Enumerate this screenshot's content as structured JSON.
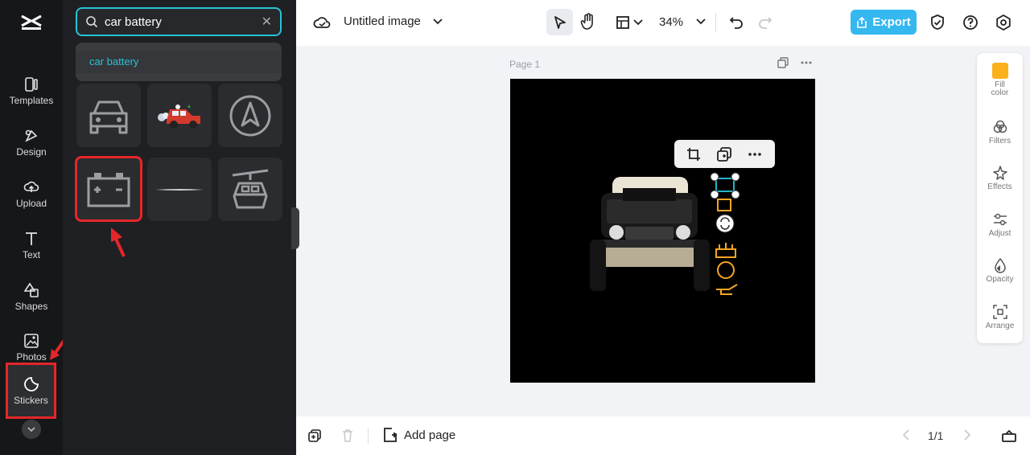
{
  "nav": {
    "items": [
      {
        "label": "Templates",
        "icon": "templates-icon"
      },
      {
        "label": "Design",
        "icon": "design-icon"
      },
      {
        "label": "Upload",
        "icon": "upload-icon"
      },
      {
        "label": "Text",
        "icon": "text-icon"
      },
      {
        "label": "Shapes",
        "icon": "shapes-icon"
      },
      {
        "label": "Photos",
        "icon": "photos-icon"
      },
      {
        "label": "Stickers",
        "icon": "stickers-icon",
        "active": true
      }
    ]
  },
  "panel": {
    "search_value": "car battery",
    "suggestion": "car battery",
    "stickers": [
      "car-outline-sticker",
      "red-car-sticker",
      "navigation-arrow-sticker",
      "car-battery-sticker",
      "horizon-line-sticker",
      "cable-car-sticker"
    ]
  },
  "topbar": {
    "title": "Untitled image",
    "zoom": "34%",
    "export_label": "Export"
  },
  "canvas": {
    "page_label": "Page 1"
  },
  "props": {
    "items": [
      {
        "label": "Fill color",
        "icon": "fill-color-icon"
      },
      {
        "label": "Filters",
        "icon": "filters-icon"
      },
      {
        "label": "Effects",
        "icon": "effects-icon"
      },
      {
        "label": "Adjust",
        "icon": "adjust-icon"
      },
      {
        "label": "Opacity",
        "icon": "opacity-icon"
      },
      {
        "label": "Arrange",
        "icon": "arrange-icon"
      }
    ],
    "fill_color": "#fbb11c"
  },
  "bottombar": {
    "add_page_label": "Add page",
    "pager": "1/1"
  },
  "colors": {
    "accent": "#28c2d6",
    "export": "#35b7f0",
    "highlight": "#e5262b"
  }
}
